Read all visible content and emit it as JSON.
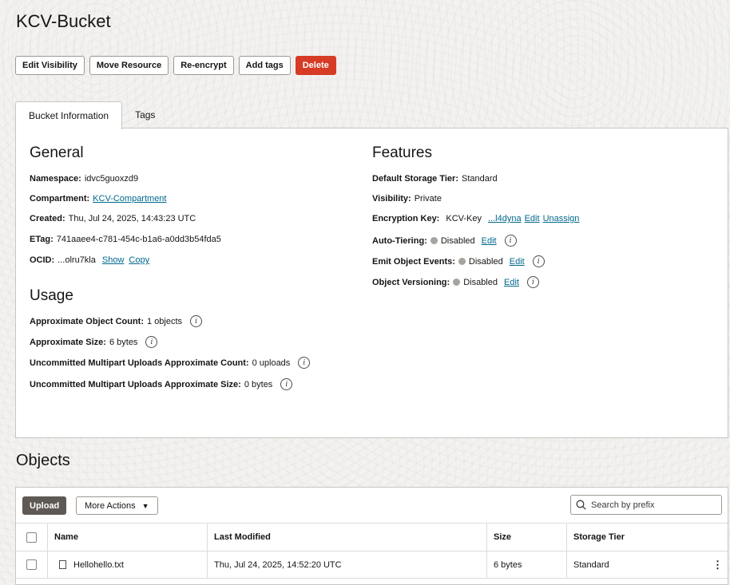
{
  "bucket": {
    "title": "KCV-Bucket"
  },
  "actions": {
    "edit_visibility": "Edit Visibility",
    "move_resource": "Move Resource",
    "re_encrypt": "Re-encrypt",
    "add_tags": "Add tags",
    "delete": "Delete"
  },
  "tabs": {
    "bucket_info": "Bucket Information",
    "tags": "Tags"
  },
  "general": {
    "heading": "General",
    "namespace_label": "Namespace:",
    "namespace_value": "idvc5guoxzd9",
    "compartment_label": "Compartment:",
    "compartment_value": "KCV-Compartment",
    "created_label": "Created:",
    "created_value": "Thu, Jul 24, 2025, 14:43:23 UTC",
    "etag_label": "ETag:",
    "etag_value": "741aaee4-c781-454c-b1a6-a0dd3b54fda5",
    "ocid_label": "OCID:",
    "ocid_value": "...olru7kla",
    "ocid_show": "Show",
    "ocid_copy": "Copy"
  },
  "usage": {
    "heading": "Usage",
    "object_count_label": "Approximate Object Count:",
    "object_count_value": "1 objects",
    "size_label": "Approximate Size:",
    "size_value": "6 bytes",
    "multipart_count_label": "Uncommitted Multipart Uploads Approximate Count:",
    "multipart_count_value": "0 uploads",
    "multipart_size_label": "Uncommitted Multipart Uploads Approximate Size:",
    "multipart_size_value": "0 bytes"
  },
  "features": {
    "heading": "Features",
    "storage_tier_label": "Default Storage Tier:",
    "storage_tier_value": "Standard",
    "visibility_label": "Visibility:",
    "visibility_value": "Private",
    "encryption_label": "Encryption Key:",
    "encryption_value": "KCV-Key",
    "encryption_id": "...l4dyna",
    "encryption_edit": "Edit",
    "encryption_unassign": "Unassign",
    "auto_tiering_label": "Auto-Tiering:",
    "auto_tiering_value": "Disabled",
    "emit_events_label": "Emit Object Events:",
    "emit_events_value": "Disabled",
    "versioning_label": "Object Versioning:",
    "versioning_value": "Disabled",
    "edit_label": "Edit"
  },
  "objects": {
    "heading": "Objects",
    "upload": "Upload",
    "more_actions": "More Actions",
    "search_placeholder": "Search by prefix",
    "columns": {
      "name": "Name",
      "last_modified": "Last Modified",
      "size": "Size",
      "storage_tier": "Storage Tier"
    },
    "rows": [
      {
        "name": "Hellohello.txt",
        "last_modified": "Thu, Jul 24, 2025, 14:52:20 UTC",
        "size": "6 bytes",
        "storage_tier": "Standard"
      }
    ]
  },
  "icons": {
    "info": "info-icon",
    "search": "search-icon",
    "file": "file-icon",
    "kebab": "kebab-menu-icon",
    "caret": "caret-down-icon"
  },
  "colors": {
    "delete": "#d63b25",
    "link": "#00688c",
    "upload": "#5e5954",
    "status_dot": "#a7a39e"
  }
}
